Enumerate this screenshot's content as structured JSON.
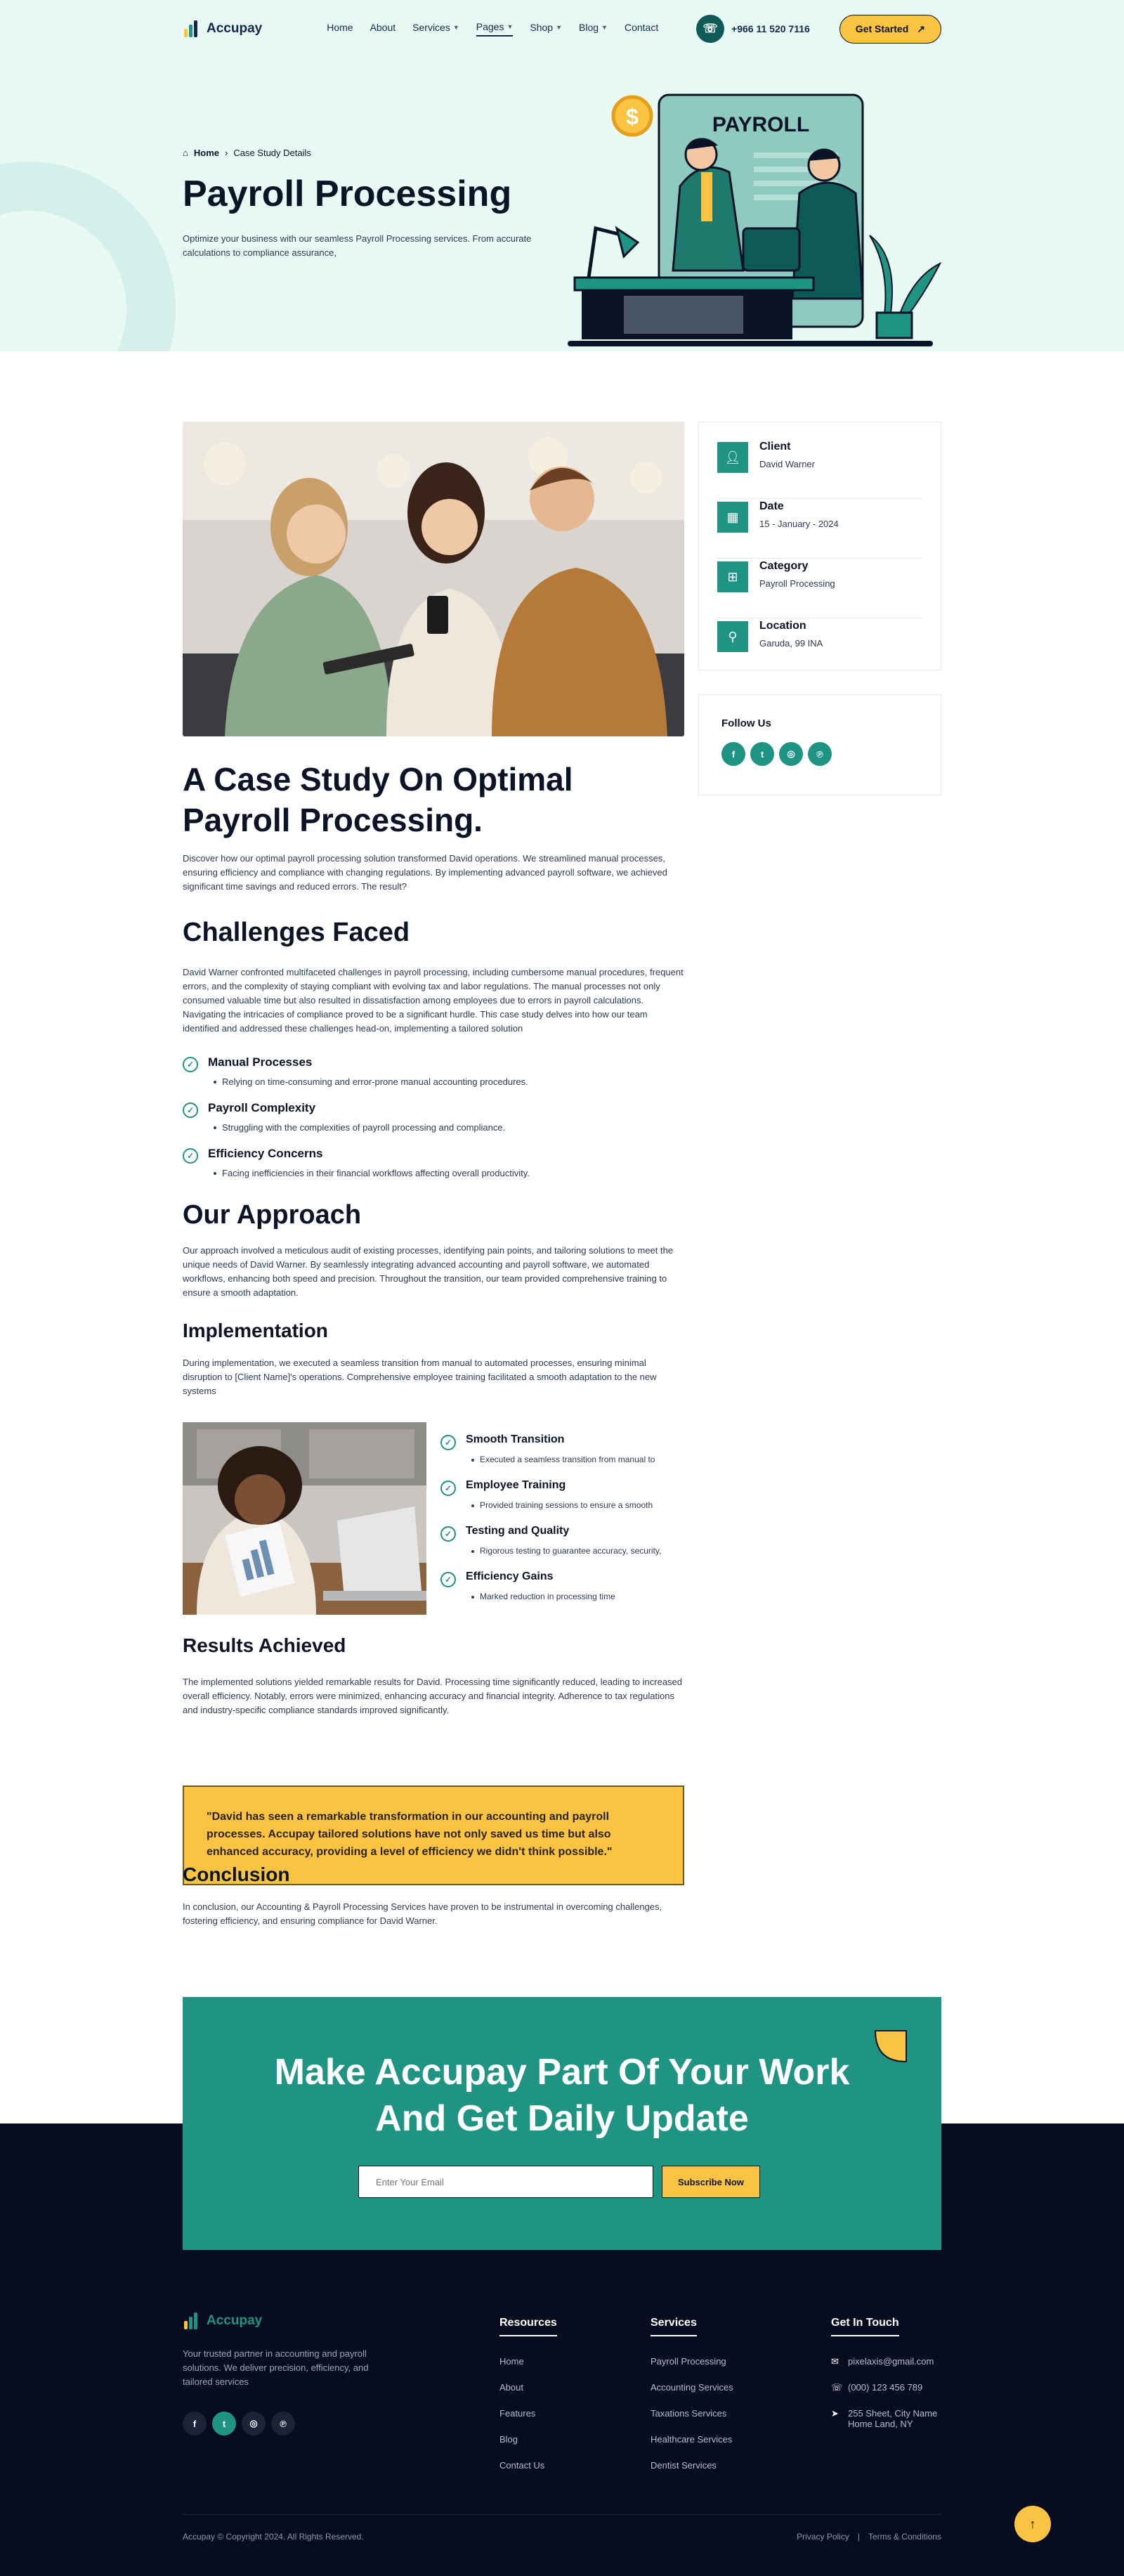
{
  "brand": {
    "name": "Accupay",
    "colors": {
      "teal": "#1f9483",
      "yellow": "#fbc342",
      "navy": "#070d1f",
      "mint": "#e9faf5"
    }
  },
  "nav": {
    "items": [
      {
        "label": "Home",
        "has_menu": false
      },
      {
        "label": "About",
        "has_menu": false
      },
      {
        "label": "Services",
        "has_menu": true
      },
      {
        "label": "Pages",
        "has_menu": true,
        "active": true
      },
      {
        "label": "Shop",
        "has_menu": true
      },
      {
        "label": "Blog",
        "has_menu": true
      },
      {
        "label": "Contact",
        "has_menu": false
      }
    ],
    "phone": "+966 11 520 7116",
    "cta": "Get Started"
  },
  "hero": {
    "breadcrumb_home": "Home",
    "breadcrumb_current": "Case Study Details",
    "title": "Payroll Processing",
    "subtitle": "Optimize your business with our seamless Payroll Processing services. From accurate calculations to compliance assurance,",
    "illustration_sign": "PAYROLL"
  },
  "sidebar": {
    "info": [
      {
        "label": "Client",
        "value": "David Warner",
        "icon": "user-icon"
      },
      {
        "label": "Date",
        "value": "15 - January - 2024",
        "icon": "calendar-icon"
      },
      {
        "label": "Category",
        "value": "Payroll Processing",
        "icon": "grid-icon"
      },
      {
        "label": "Location",
        "value": "Garuda, 99 INA",
        "icon": "location-pin-icon"
      }
    ],
    "follow_title": "Follow Us"
  },
  "article": {
    "title": "A Case Study On Optimal Payroll Processing.",
    "intro": "Discover how our optimal payroll processing solution transformed David operations. We streamlined manual processes, ensuring efficiency and compliance with changing regulations. By implementing advanced payroll software, we achieved significant time savings and reduced errors. The result?",
    "challenges_title": "Challenges Faced",
    "challenges_text": "David Warner confronted multifaceted challenges in payroll processing, including cumbersome manual procedures, frequent errors, and the complexity of staying compliant with evolving tax and labor regulations. The manual processes not only consumed valuable time but also resulted in dissatisfaction among employees due to errors in payroll calculations. Navigating the intricacies of compliance proved to be a significant hurdle. This case study delves into how our team identified and addressed these challenges head-on, implementing a tailored solution",
    "challenges": [
      {
        "title": "Manual Processes",
        "desc": "Relying on time-consuming and error-prone manual accounting procedures."
      },
      {
        "title": "Payroll Complexity",
        "desc": "Struggling with the complexities of payroll processing and compliance."
      },
      {
        "title": "Efficiency Concerns",
        "desc": "Facing inefficiencies in their financial workflows affecting overall productivity."
      }
    ],
    "approach_title": "Our Approach",
    "approach_text": "Our approach involved a meticulous audit of existing processes, identifying pain points, and tailoring solutions to meet the unique needs of David Warner. By seamlessly integrating advanced accounting and payroll software, we automated workflows, enhancing both speed and precision. Throughout the transition, our team provided comprehensive training to ensure a smooth adaptation.",
    "implementation_title": "Implementation",
    "implementation_text": "During implementation, we executed a seamless transition from manual to automated processes, ensuring minimal disruption to [Client Name]'s operations. Comprehensive employee training facilitated a smooth adaptation to the new systems",
    "implementation_points": [
      {
        "title": "Smooth Transition",
        "desc": "Executed a seamless transition from manual to"
      },
      {
        "title": "Employee Training",
        "desc": "Provided training sessions to ensure a smooth"
      },
      {
        "title": "Testing and Quality",
        "desc": "Rigorous testing to guarantee accuracy, security,"
      },
      {
        "title": "Efficiency Gains",
        "desc": "Marked reduction in processing time"
      }
    ],
    "results_title": "Results Achieved",
    "results_text": "The implemented solutions yielded remarkable results for David. Processing time significantly reduced, leading to increased overall efficiency. Notably, errors were minimized, enhancing accuracy and financial integrity. Adherence to tax regulations and industry-specific compliance standards improved significantly.",
    "quote": "\"David has seen a remarkable transformation in our accounting and payroll processes. Accupay tailored solutions have not only saved us time but also enhanced accuracy, providing a level of efficiency we didn't think possible.\"",
    "conclusion_title": "Conclusion",
    "conclusion_text": "In conclusion, our Accounting & Payroll Processing Services have proven to be instrumental in overcoming challenges, fostering efficiency, and ensuring compliance for David Warner."
  },
  "newsletter": {
    "title_line1": "Make Accupay Part Of Your Work",
    "title_line2": "And Get Daily Update",
    "placeholder": "Enter Your Email",
    "button": "Subscribe Now"
  },
  "footer": {
    "about": "Your trusted partner in accounting and payroll solutions. We deliver precision, efficiency, and tailored services",
    "resources_title": "Resources",
    "resources": [
      "Home",
      "About",
      "Features",
      "Blog",
      "Contact Us"
    ],
    "services_title": "Services",
    "services": [
      "Payroll Processing",
      "Accounting Services",
      "Taxations Services",
      "Healthcare Services",
      "Dentist Services"
    ],
    "contact_title": "Get In Touch",
    "email": "pixelaxis@gmail.com",
    "phone": "(000) 123 456 789",
    "address_line1": "255 Sheet, City Name",
    "address_line2": "Home Land, NY",
    "copyright": "Accupay © Copyright 2024. All Rights Reserved.",
    "privacy": "Privacy Policy",
    "separator": "|",
    "terms": "Terms & Conditions"
  }
}
